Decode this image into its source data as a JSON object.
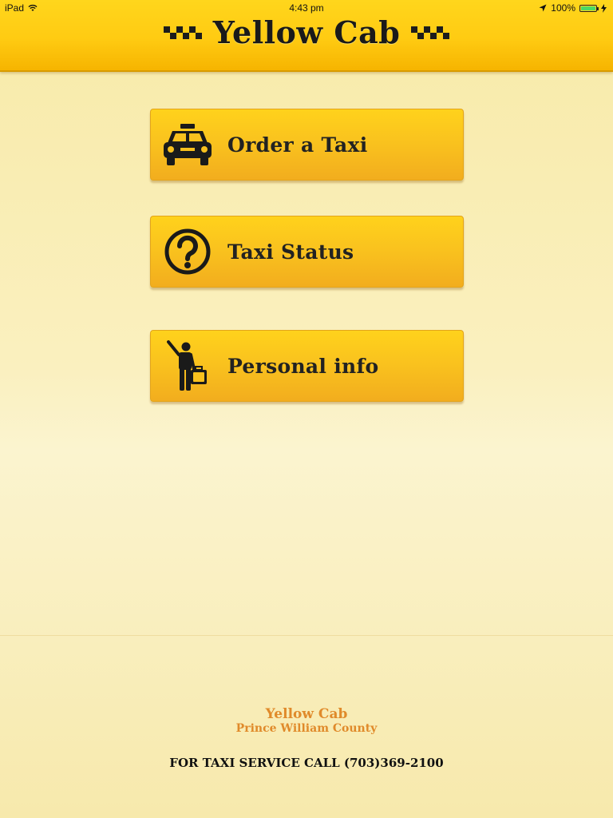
{
  "status_bar": {
    "device": "iPad",
    "time": "4:43 pm",
    "battery": "100%",
    "battery_level_percent": 100
  },
  "header": {
    "title": "Yellow Cab"
  },
  "menu": [
    {
      "label": "Order a Taxi",
      "icon": "taxi-icon"
    },
    {
      "label": "Taxi Status",
      "icon": "question-icon"
    },
    {
      "label": "Personal info",
      "icon": "person-luggage-icon"
    }
  ],
  "footer": {
    "brand_name": "Yellow Cab",
    "county": "Prince William County",
    "call_text": "FOR TAXI SERVICE CALL (703)369-2100"
  },
  "colors": {
    "header_yellow": "#ffcb12",
    "button_yellow": "#f9c11e",
    "footer_orange": "#e08a2a",
    "text_dark": "#222222"
  }
}
